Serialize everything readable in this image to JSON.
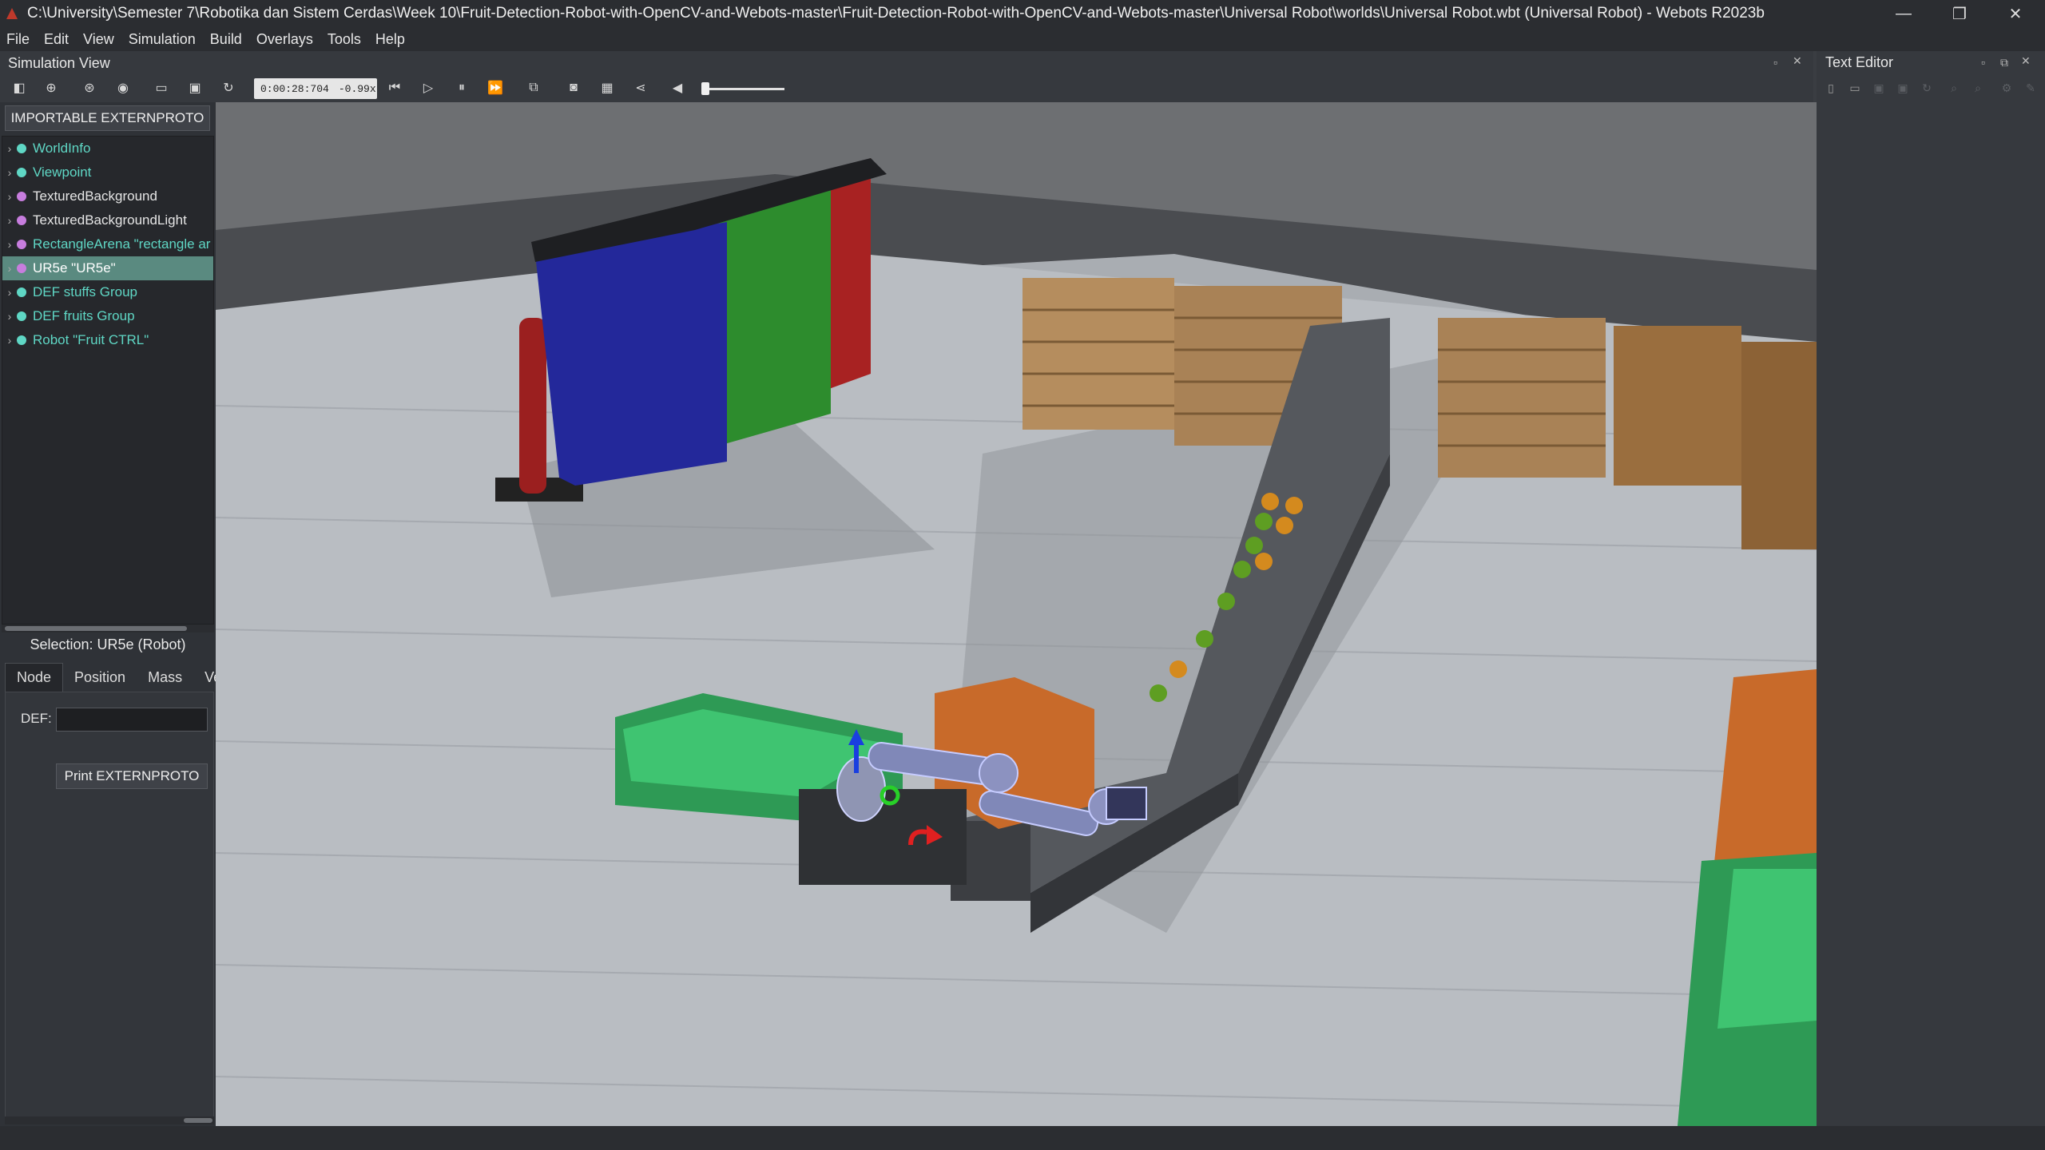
{
  "window": {
    "title": "C:\\University\\Semester 7\\Robotika dan Sistem Cerdas\\Week 10\\Fruit-Detection-Robot-with-OpenCV-and-Webots-master\\Fruit-Detection-Robot-with-OpenCV-and-Webots-master\\Universal Robot\\worlds\\Universal Robot.wbt (Universal Robot) - Webots R2023b",
    "minimize": "—",
    "restore": "❐",
    "close": "✕"
  },
  "menu": [
    "File",
    "Edit",
    "View",
    "Simulation",
    "Build",
    "Overlays",
    "Tools",
    "Help"
  ],
  "sim_view": {
    "title": "Simulation View",
    "time": "0:00:28:704",
    "speed": "0.99x",
    "time_sep": "-"
  },
  "scene_tree": {
    "import_button": "IMPORTABLE EXTERNPROTO",
    "nodes": [
      {
        "label": "WorldInfo",
        "color": "#5fd7c5",
        "text_color": "#5fd7c5"
      },
      {
        "label": "Viewpoint",
        "color": "#5fd7c5",
        "text_color": "#5fd7c5"
      },
      {
        "label": "TexturedBackground",
        "color": "#c77dde",
        "text_color": "#e6e6e6"
      },
      {
        "label": "TexturedBackgroundLight",
        "color": "#c77dde",
        "text_color": "#e6e6e6"
      },
      {
        "label": "RectangleArena \"rectangle ar",
        "color": "#c77dde",
        "text_color": "#5fd7c5"
      },
      {
        "label": "UR5e \"UR5e\"",
        "color": "#c77dde",
        "text_color": "#ffffff"
      },
      {
        "label": "DEF stuffs Group",
        "color": "#5fd7c5",
        "text_color": "#5fd7c5"
      },
      {
        "label": "DEF fruits Group",
        "color": "#5fd7c5",
        "text_color": "#5fd7c5"
      },
      {
        "label": "Robot \"Fruit CTRL\"",
        "color": "#5fd7c5",
        "text_color": "#5fd7c5"
      }
    ],
    "selected_index": 5
  },
  "properties": {
    "selection": "Selection: UR5e (Robot)",
    "tabs": [
      "Node",
      "Position",
      "Mass",
      "Ve"
    ],
    "active_tab": "Node",
    "def_label": "DEF:",
    "def_value": "",
    "print_button": "Print EXTERNPROTO"
  },
  "text_editor": {
    "title": "Text Editor"
  }
}
